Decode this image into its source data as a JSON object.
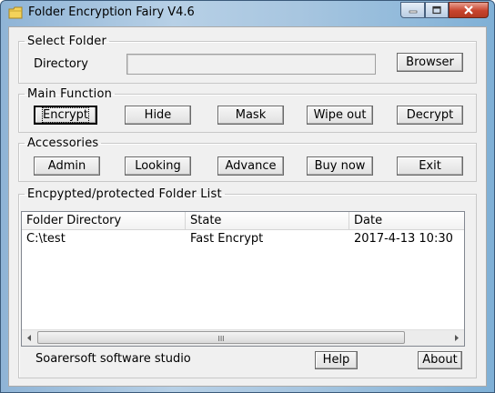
{
  "window": {
    "title": "Folder Encryption Fairy V4.6"
  },
  "select_folder": {
    "legend": "Select Folder",
    "directory_label": "Directory",
    "directory_value": "",
    "browser_button": "Browser"
  },
  "main_function": {
    "legend": "Main Function",
    "buttons": [
      "Encrypt",
      "Hide",
      "Mask",
      "Wipe out",
      "Decrypt"
    ]
  },
  "accessories": {
    "legend": "Accessories",
    "buttons": [
      "Admin",
      "Looking",
      "Advance",
      "Buy now",
      "Exit"
    ]
  },
  "folder_list": {
    "legend": "Encpypted/protected Folder List",
    "columns": [
      "Folder Directory",
      "State",
      "Date"
    ],
    "rows": [
      {
        "directory": "C:\\test",
        "state": "Fast Encrypt",
        "date": "2017-4-13 10:30"
      }
    ],
    "scroll_grip": "III"
  },
  "footer": {
    "studio": "Soarersoft software studio",
    "help_button": "Help",
    "about_button": "About"
  }
}
